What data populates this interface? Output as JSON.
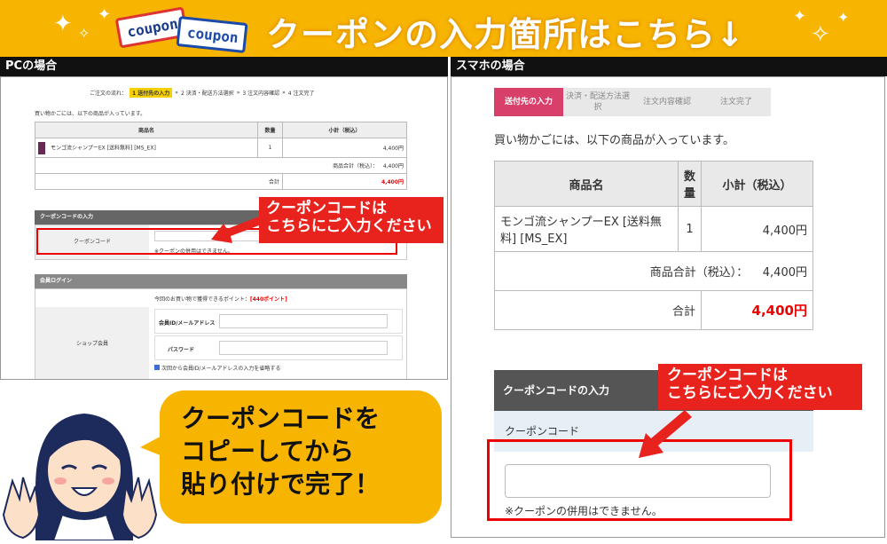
{
  "banner": {
    "title": "クーポンの入力箇所はこちら↓",
    "coupon_word": "coupon"
  },
  "pc": {
    "header": "PCの場合",
    "flow": {
      "lead": "ご注文の流れ：",
      "s1": "1 送付先の入力",
      "s2": "2 決済・配送方法選択",
      "s3": "3 注文内容確認",
      "s4": "4 注文完了"
    },
    "cart_note": "買い物かごには、以下の商品が入っています。",
    "table": {
      "h_name": "商品名",
      "h_qty": "数量",
      "h_sub": "小計（税込）",
      "item": "モンゴ流シャンプーEX [送料無料] [MS_EX]",
      "qty": "1",
      "price": "4,400円",
      "total_label": "商品合計（税込）：",
      "total": "4,400円",
      "sum_label": "合計",
      "sum": "4,400円"
    },
    "coupon": {
      "bar": "クーポンコードの入力",
      "label": "クーポンコード",
      "note": "※クーポンの併用はできません。"
    },
    "login": {
      "bar": "会員ログイン",
      "points": "今回のお買い物で獲得できるポイント：",
      "points_val": "[440ポイント]",
      "member": "ショップ会員",
      "id_label": "会員ID/メールアドレス",
      "pw_label": "パスワード",
      "remember": "次回から会員ID/メールアドレスの入力を省略する"
    },
    "callout": "クーポンコードは\nこちらにご入力ください"
  },
  "sp": {
    "header": "スマホの場合",
    "steps": [
      "送付先の入力",
      "決済・配送方法選択",
      "注文内容確認",
      "注文完了"
    ],
    "cart_note": "買い物かごには、以下の商品が入っています。",
    "table": {
      "h_name": "商品名",
      "h_qty": "数量",
      "h_sub": "小計（税込）",
      "item": "モンゴ流シャンプーEX [送料無料] [MS_EX]",
      "qty": "1",
      "price": "4,400円",
      "total_label": "商品合計（税込）：",
      "total": "4,400円",
      "sum_label": "合計",
      "sum": "4,400円"
    },
    "coupon": {
      "bar": "クーポンコードの入力",
      "label": "クーポンコード",
      "note": "※クーポンの併用はできません。"
    },
    "callout": "クーポンコードは\nこちらにご入力ください"
  },
  "bubble": {
    "text": "クーポンコードを\nコピーしてから\n貼り付けで完了！"
  }
}
